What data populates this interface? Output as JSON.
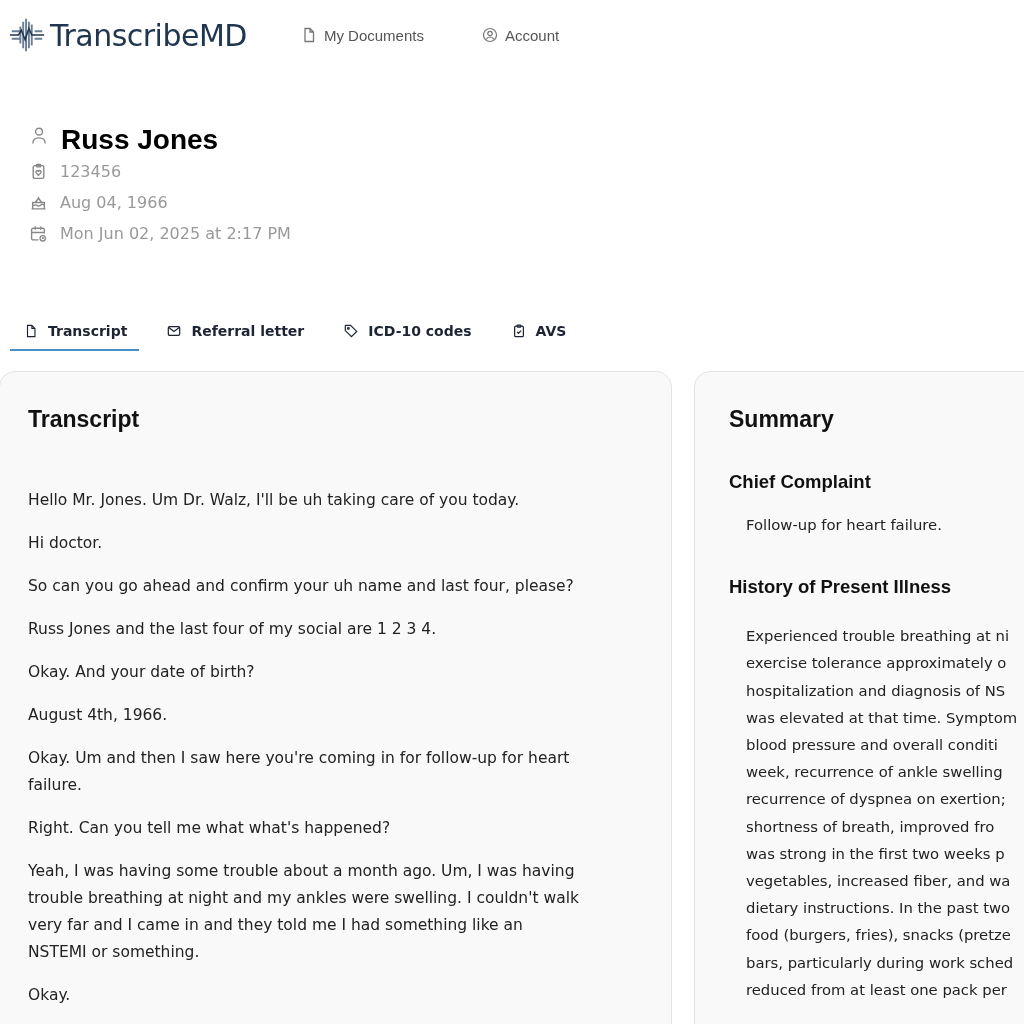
{
  "brand": "TranscribeMD",
  "nav": [
    {
      "kind": "document",
      "label": "My Documents"
    },
    {
      "kind": "account",
      "label": "Account"
    }
  ],
  "patient": {
    "name": "Russ Jones",
    "details": [
      {
        "kind": "id",
        "text": "123456"
      },
      {
        "kind": "birthday",
        "text": "Aug 04, 1966"
      },
      {
        "kind": "visit",
        "text": "Mon Jun 02, 2025 at 2:17 PM"
      }
    ]
  },
  "tabs": [
    {
      "kind": "document",
      "label": "Transcript",
      "selected": true
    },
    {
      "kind": "mail",
      "label": "Referral letter",
      "selected": false
    },
    {
      "kind": "tag",
      "label": "ICD-10 codes",
      "selected": false
    },
    {
      "kind": "clipboard",
      "label": "AVS",
      "selected": false
    }
  ],
  "transcript": {
    "title": "Transcript",
    "lines": [
      "Hello Mr. Jones. Um Dr. Walz, I'll be uh taking care of you today.",
      "Hi doctor.",
      "So can you go ahead and confirm your uh name and last four, please?",
      "Russ Jones and the last four of my social are 1 2 3 4.",
      "Okay. And your date of birth?",
      "August 4th, 1966.",
      "Okay. Um and then I saw here you're coming in for follow-up for heart failure.",
      "Right. Can you tell me what what's happened?",
      "Yeah, I was having some trouble about a month ago. Um, I was having trouble breathing at night and my ankles were swelling. I couldn't walk very far and I came in and they told me I had something like an NSTEMI or something.",
      "Okay."
    ]
  },
  "summary": {
    "title": "Summary",
    "sections": [
      {
        "heading": "Chief Complaint",
        "lines": [
          "Follow-up for heart failure."
        ]
      },
      {
        "heading": "History of Present Illness",
        "lines": [
          "Experienced trouble breathing at ni",
          "exercise tolerance approximately o",
          "hospitalization and diagnosis of NS",
          "was elevated at that time. Symptom",
          "blood pressure and overall conditi",
          "week, recurrence of ankle swelling",
          "recurrence of dyspnea on exertion;",
          "shortness of breath, improved fro",
          "was strong in the first two weeks p",
          "vegetables, increased fiber, and wa",
          "dietary instructions. In the past two",
          "food (burgers, fries), snacks (pretze",
          "bars, particularly during work sched",
          "reduced from at least one pack per"
        ]
      }
    ]
  }
}
